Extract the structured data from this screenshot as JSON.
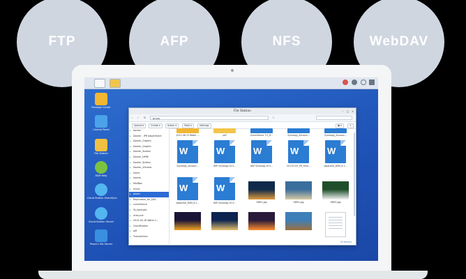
{
  "protocols": [
    "FTP",
    "AFP",
    "NFS",
    "WebDAV"
  ],
  "desktop": [
    {
      "label": "Package Center",
      "icon": "package-center-icon",
      "color": "#f2b632"
    },
    {
      "label": "Control Panel",
      "icon": "control-panel-icon",
      "color": "#4aa3e8"
    },
    {
      "label": "File Station",
      "icon": "file-station-icon",
      "color": "#f0c040"
    },
    {
      "label": "DSM Help",
      "icon": "help-icon",
      "color": "#7cc242"
    },
    {
      "label": "Cloud Station ShareSync",
      "icon": "cloud-sync-icon",
      "color": "#53b6f0"
    },
    {
      "label": "Cloud Station Server",
      "icon": "cloud-server-icon",
      "color": "#53b6f0"
    },
    {
      "label": "Photo's File Server",
      "icon": "photo-server-icon",
      "color": "#3a8fe0"
    }
  ],
  "window": {
    "title": "File Station",
    "path": "photo",
    "toolbar": [
      "Upload ▾",
      "Create ▾",
      "Action ▾",
      "Tools ▾",
      "Settings"
    ],
    "tree": [
      "docker",
      "Docker - IPR department",
      "Docker_Graphic",
      "Docker_Graphic",
      "Docker_Station",
      "Docker_DPRE",
      "Docker_Station",
      "Docker_Vthumb",
      "home",
      "homes",
      "MailBox",
      "music",
      "photo",
      "Replication_for_DAC",
      "surveillance",
      "To_replicate",
      "#recycle",
      "2015-04-18 Water C...",
      "CloudStation",
      "pdf",
      "Transactions"
    ],
    "selected_tree_item": "photo",
    "files": [
      {
        "name": "",
        "kind": "folder",
        "color": "#f2b632"
      },
      {
        "name": "",
        "kind": "folder",
        "color": "#f2c54a"
      },
      {
        "name": "",
        "kind": "folder",
        "color": "#2b7cd3"
      },
      {
        "name": "",
        "kind": "folder",
        "color": "#2b7cd3"
      },
      {
        "name": "",
        "kind": "folder",
        "color": "#2b7cd3"
      },
      {
        "name": "2011-06-13 Water ...",
        "kind": "blank"
      },
      {
        "name": "pdf",
        "kind": "blank"
      },
      {
        "name": "Surveillance 7.0_R...",
        "kind": "blank"
      },
      {
        "name": "Synology_Announ...",
        "kind": "blank"
      },
      {
        "name": "Synology_Announ...",
        "kind": "blank"
      },
      {
        "name": "Synology_announ...",
        "kind": "word"
      },
      {
        "name": "HAP Synology et S...",
        "kind": "word"
      },
      {
        "name": "HAP Synology et S...",
        "kind": "word"
      },
      {
        "name": "20170125_PR_Final...",
        "kind": "word"
      },
      {
        "name": "Japanese_DSM_6.1...",
        "kind": "word"
      },
      {
        "name": "Japanese_DSM_6.1...",
        "kind": "word"
      },
      {
        "name": "HAP Synology et S...",
        "kind": "word"
      },
      {
        "name": "HDR1.jpg",
        "kind": "photo",
        "colors": [
          "#0f2a4a",
          "#e29b3c"
        ]
      },
      {
        "name": "HDR2.jpg",
        "kind": "photo",
        "colors": [
          "#3a6e9c",
          "#d8c9a3"
        ]
      },
      {
        "name": "HDR3.jpg",
        "kind": "photo",
        "colors": [
          "#1f4f2a",
          "#f3f3f3"
        ]
      },
      {
        "name": "",
        "kind": "photo",
        "colors": [
          "#1a1436",
          "#f5a423"
        ]
      },
      {
        "name": "",
        "kind": "photo",
        "colors": [
          "#0b2450",
          "#e7c16a"
        ]
      },
      {
        "name": "",
        "kind": "photo",
        "colors": [
          "#2a1a3a",
          "#ff8f2e"
        ]
      },
      {
        "name": "",
        "kind": "photo",
        "colors": [
          "#3d7fb8",
          "#9e6f3b"
        ]
      },
      {
        "name": "",
        "kind": "paper"
      }
    ],
    "item_count": "25 item(s)"
  }
}
